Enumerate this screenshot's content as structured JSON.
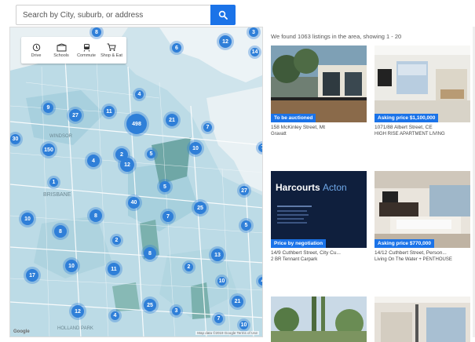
{
  "search": {
    "placeholder": "Search by City, suburb, or address"
  },
  "map": {
    "tools": [
      {
        "label": "Drive",
        "icon": "car-clock-icon"
      },
      {
        "label": "Schools",
        "icon": "school-icon"
      },
      {
        "label": "Commute",
        "icon": "train-icon"
      },
      {
        "label": "Shop & Eat",
        "icon": "cart-icon"
      }
    ],
    "clusters": [
      "12",
      "8",
      "3",
      "6",
      "14",
      "9",
      "4",
      "27",
      "11",
      "498",
      "21",
      "7",
      "30",
      "150",
      "2",
      "10",
      "7",
      "4",
      "12",
      "5",
      "1",
      "5",
      "27",
      "8",
      "40",
      "25",
      "7",
      "10",
      "5",
      "8",
      "2",
      "8",
      "13",
      "10",
      "11",
      "2",
      "17",
      "4",
      "10",
      "25",
      "12",
      "3",
      "21",
      "4",
      "7",
      "10",
      "5",
      "10",
      "6"
    ],
    "attribution": "Map data ©2019 Google  Terms of Use"
  },
  "results": {
    "header": "We found 1063 listings in the area, showing 1 - 20"
  },
  "listings": [
    {
      "badge": "To be auctioned",
      "address": "158 McKinley Street, Mt",
      "subtitle": "Gravatt"
    },
    {
      "badge": "Asking price $1,100,000",
      "address": "1071/88 Albert Street, CE",
      "subtitle": "HIGH RISE APARTMENT LIVING"
    },
    {
      "badge": "Price by negotiation",
      "address": "14/9 Cuthbert Street, City Cu...",
      "subtitle": "2 BR Tennant Carpark",
      "brand": "Harcourts",
      "brand_sub": "Acton"
    },
    {
      "badge": "Asking price $770,000",
      "address": "14/12 Cuthbert Street, Person...",
      "subtitle": "Living On The Water + PENTHOUSE"
    },
    {
      "badge": "",
      "address": "",
      "subtitle": ""
    },
    {
      "badge": "",
      "address": "",
      "subtitle": ""
    }
  ]
}
